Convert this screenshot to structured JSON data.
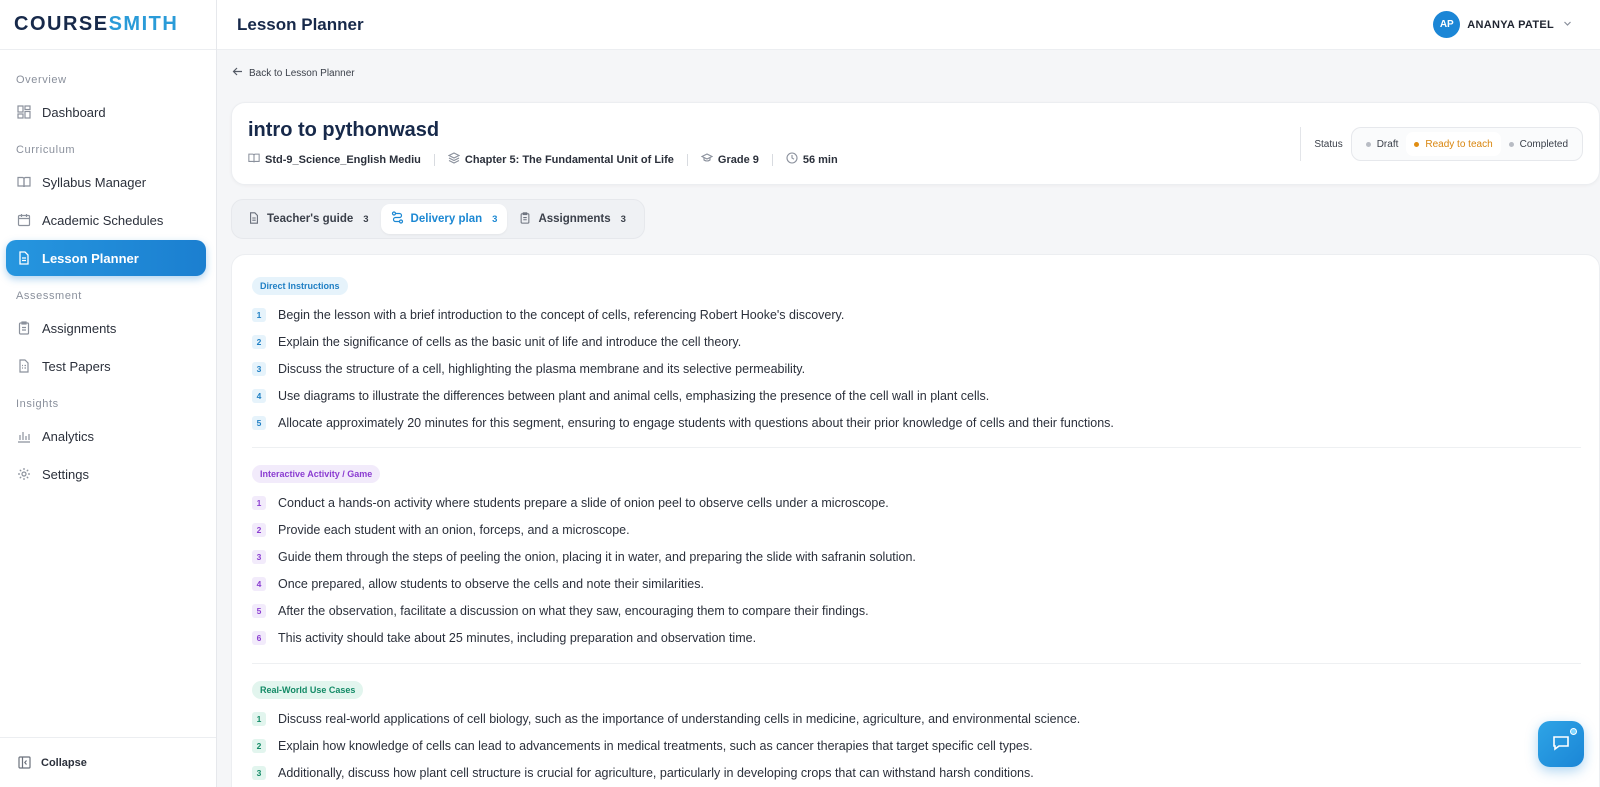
{
  "brand": {
    "part1": "COURSE",
    "part2": "SMITH"
  },
  "topbar": {
    "title": "Lesson Planner"
  },
  "user": {
    "initials": "AP",
    "name": "ANANYA PATEL"
  },
  "sidebar": {
    "sections": [
      {
        "label": "Overview",
        "items": [
          {
            "label": "Dashboard",
            "icon": "dashboard-icon"
          }
        ]
      },
      {
        "label": "Curriculum",
        "items": [
          {
            "label": "Syllabus Manager",
            "icon": "book-icon"
          },
          {
            "label": "Academic Schedules",
            "icon": "calendar-icon"
          },
          {
            "label": "Lesson Planner",
            "icon": "document-icon",
            "active": true
          }
        ]
      },
      {
        "label": "Assessment",
        "items": [
          {
            "label": "Assignments",
            "icon": "clipboard-icon"
          },
          {
            "label": "Test Papers",
            "icon": "test-paper-icon"
          }
        ]
      },
      {
        "label": "Insights",
        "items": [
          {
            "label": "Analytics",
            "icon": "bar-chart-icon"
          },
          {
            "label": "Settings",
            "icon": "gear-icon"
          }
        ]
      }
    ],
    "collapse_label": "Collapse"
  },
  "back_link": "Back to Lesson Planner",
  "lesson": {
    "title": "intro to pythonwasd",
    "syllabus": "Std-9_Science_English Mediu",
    "chapter": "Chapter 5: The Fundamental Unit of Life",
    "grade": "Grade 9",
    "duration": "56 min"
  },
  "status": {
    "label": "Status",
    "options": [
      "Draft",
      "Ready to teach",
      "Completed"
    ],
    "selected": "Ready to teach",
    "accent": "#e08d12"
  },
  "tabs": [
    {
      "label": "Teacher's guide",
      "count": "3"
    },
    {
      "label": "Delivery plan",
      "count": "3",
      "active": true
    },
    {
      "label": "Assignments",
      "count": "3"
    }
  ],
  "sections": [
    {
      "tag": "Direct Instructions",
      "color": "blue",
      "steps": [
        "Begin the lesson with a brief introduction to the concept of cells, referencing Robert Hooke's discovery.",
        "Explain the significance of cells as the basic unit of life and introduce the cell theory.",
        "Discuss the structure of a cell, highlighting the plasma membrane and its selective permeability.",
        "Use diagrams to illustrate the differences between plant and animal cells, emphasizing the presence of the cell wall in plant cells.",
        "Allocate approximately 20 minutes for this segment, ensuring to engage students with questions about their prior knowledge of cells and their functions."
      ]
    },
    {
      "tag": "Interactive Activity / Game",
      "color": "purple",
      "steps": [
        "Conduct a hands-on activity where students prepare a slide of onion peel to observe cells under a microscope.",
        "Provide each student with an onion, forceps, and a microscope.",
        "Guide them through the steps of peeling the onion, placing it in water, and preparing the slide with safranin solution.",
        "Once prepared, allow students to observe the cells and note their similarities.",
        "After the observation, facilitate a discussion on what they saw, encouraging them to compare their findings.",
        "This activity should take about 25 minutes, including preparation and observation time."
      ]
    },
    {
      "tag": "Real-World Use Cases",
      "color": "green",
      "steps": [
        "Discuss real-world applications of cell biology, such as the importance of understanding cells in medicine, agriculture, and environmental science.",
        "Explain how knowledge of cells can lead to advancements in medical treatments, such as cancer therapies that target specific cell types.",
        "Additionally, discuss how plant cell structure is crucial for agriculture, particularly in developing crops that can withstand harsh conditions."
      ]
    }
  ]
}
